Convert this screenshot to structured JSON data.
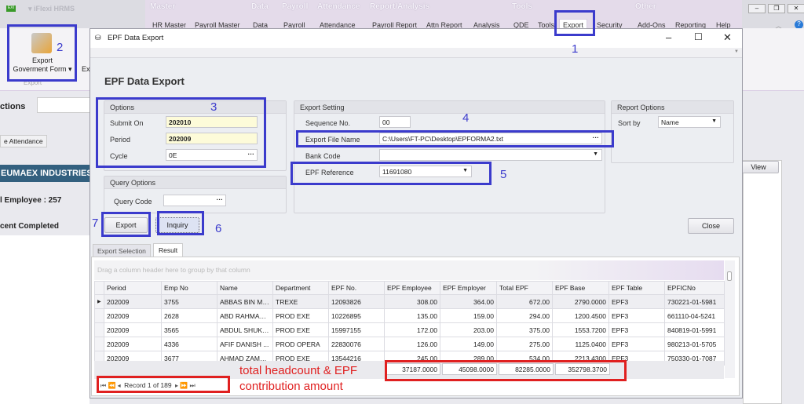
{
  "app": {
    "title": "iFlexi HRMS",
    "logo_text": "EXI"
  },
  "ribbon": {
    "categories": [
      "Master",
      "Data",
      "Payroll",
      "Attendance",
      "Report/Analysis",
      "Tools",
      "Other"
    ],
    "tabs": [
      "HR Master",
      "Payroll Master",
      "Data",
      "Payroll",
      "Attendance",
      "Payroll Report",
      "Attn Report",
      "Analysis",
      "QDE",
      "Tools",
      "Export",
      "Security",
      "Add-Ons",
      "Reporting",
      "Help"
    ],
    "active_tab": "Export",
    "export_gov_button": "Export\nGoverment Form",
    "export_gov_line1": "Export",
    "export_gov_line2": "Goverment Form",
    "next_button_partial": "Ex",
    "group_label": "Export"
  },
  "background": {
    "actions_label": "ctions",
    "attendance_tab": "e Attendance",
    "company_banner": "EUMAEX INDUSTRIES (",
    "total_employee": "l Employee : 257",
    "completed": "cent Completed",
    "view_button": "View"
  },
  "dialog": {
    "title": "EPF Data Export",
    "heading": "EPF Data Export",
    "options": {
      "title": "Options",
      "submit_on_label": "Submit On",
      "submit_on": "202010",
      "period_label": "Period",
      "period": "202009",
      "cycle_label": "Cycle",
      "cycle": "0E"
    },
    "query_options": {
      "title": "Query Options",
      "query_code_label": "Query Code",
      "query_code": ""
    },
    "export_setting": {
      "title": "Export Setting",
      "sequence_label": "Sequence No.",
      "sequence": "00",
      "file_label": "Export File Name",
      "file": "C:\\Users\\FT-PC\\Desktop\\EPFORMA2.txt",
      "bank_label": "Bank Code",
      "bank": "",
      "epf_ref_label": "EPF Reference",
      "epf_ref": "11691080"
    },
    "report_options": {
      "title": "Report Options",
      "sort_label": "Sort by",
      "sort": "Name"
    },
    "buttons": {
      "export": "Export",
      "inquiry": "Inquiry",
      "close": "Close"
    },
    "tabs": [
      "Export Selection",
      "Result"
    ],
    "active_tab": "Result",
    "grid": {
      "group_hint": "Drag a column header here to group by that column",
      "columns": [
        "Period",
        "Emp No",
        "Name",
        "Department",
        "EPF No.",
        "EPF Employee",
        "EPF Employer",
        "Total EPF",
        "EPF Base",
        "EPF Table",
        "EPFICNo"
      ],
      "rows": [
        [
          "202009",
          "3755",
          "ABBAS BIN MO...",
          "TREXE",
          "12093826",
          "308.00",
          "364.00",
          "672.00",
          "2790.0000",
          "EPF3",
          "730221-01-5981"
        ],
        [
          "202009",
          "2628",
          "ABD RAHMAN ...",
          "PROD EXE",
          "10226895",
          "135.00",
          "159.00",
          "294.00",
          "1200.4500",
          "EPF3",
          "661110-04-5241"
        ],
        [
          "202009",
          "3565",
          "ABDUL SHUKU...",
          "PROD EXE",
          "15997155",
          "172.00",
          "203.00",
          "375.00",
          "1553.7200",
          "EPF3",
          "840819-01-5991"
        ],
        [
          "202009",
          "4336",
          "AFIF DANISH ...",
          "PROD OPERA",
          "22830076",
          "126.00",
          "149.00",
          "275.00",
          "1125.0400",
          "EPF3",
          "980213-01-5705"
        ],
        [
          "202009",
          "3677",
          "AHMAD ZAMRI...",
          "PROD EXE",
          "13544216",
          "245.00",
          "289.00",
          "534.00",
          "2213.4300",
          "EPF3",
          "750330-01-7087"
        ]
      ],
      "totals": {
        "epf_employee": "37187.0000",
        "epf_employer": "45098.0000",
        "total_epf": "82285.0000",
        "epf_base": "352798.3700"
      },
      "navigator": "Record 1 of 189"
    }
  },
  "annotations": {
    "steps": [
      "1",
      "2",
      "3",
      "4",
      "5",
      "6",
      "7"
    ],
    "note_line1": "total headcount & EPF",
    "note_line2": "contribution amount",
    "blue": "#3b3bcc",
    "red": "#e02020"
  }
}
